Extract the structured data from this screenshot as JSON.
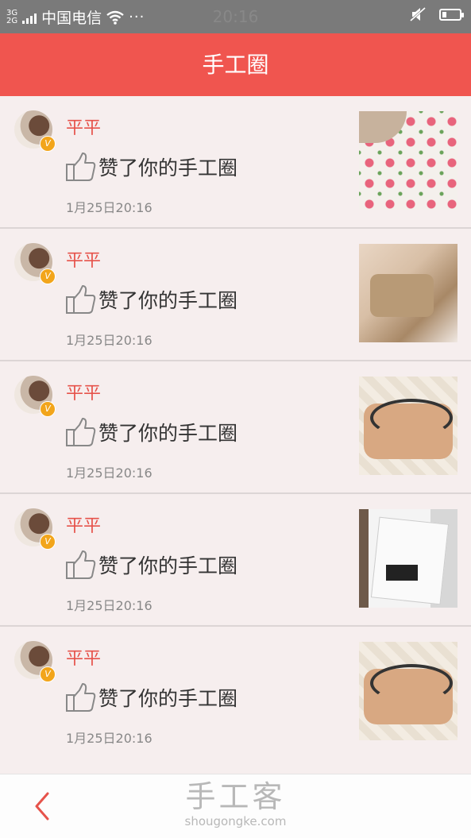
{
  "status_bar": {
    "network_type_top": "3G",
    "network_type_bottom": "2G",
    "carrier": "中国电信",
    "more": "···",
    "time": "20:16",
    "icons": [
      "signal-icon",
      "wifi-icon",
      "mute-icon",
      "battery-icon"
    ]
  },
  "header": {
    "title": "手工圈"
  },
  "notifications": [
    {
      "user": "平平",
      "badge": "V",
      "action": "赞了你的手工圈",
      "time": "1月25日20:16",
      "thumbnail": "strawberry-fabric-photo"
    },
    {
      "user": "平平",
      "badge": "V",
      "action": "赞了你的手工圈",
      "time": "1月25日20:16",
      "thumbnail": "fabric-pouch-photo"
    },
    {
      "user": "平平",
      "badge": "V",
      "action": "赞了你的手工圈",
      "time": "1月25日20:16",
      "thumbnail": "bow-hairband-photo"
    },
    {
      "user": "平平",
      "badge": "V",
      "action": "赞了你的手工圈",
      "time": "1月25日20:16",
      "thumbnail": "paris-bag-photo"
    },
    {
      "user": "平平",
      "badge": "V",
      "action": "赞了你的手工圈",
      "time": "1月25日20:16",
      "thumbnail": "bow-hairband-photo"
    }
  ],
  "bottom_bar": {
    "back_icon": "chevron-left-icon",
    "brand_cn": "手工客",
    "brand_en": "shougongke.com"
  },
  "colors": {
    "accent": "#f0554f",
    "username": "#e6534b",
    "background": "#f6eeee",
    "badge": "#f2a51b"
  }
}
